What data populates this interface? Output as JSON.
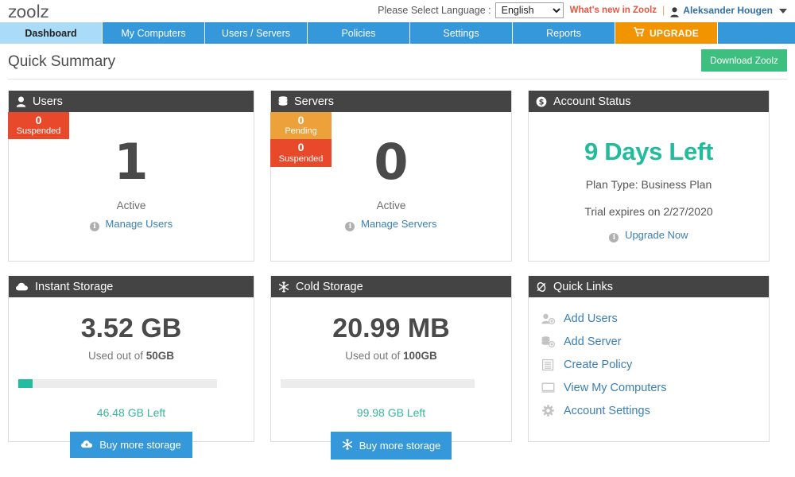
{
  "brand": {
    "logo_text": "zoolz"
  },
  "header": {
    "language_label": "Please Select Language :",
    "language_selected": "English",
    "language_options": [
      "English"
    ],
    "whats_new": "What's new in Zoolz",
    "separator": "|",
    "user_name": "Aleksander Hougen",
    "user_icon": "user-icon",
    "caret_icon": "chevron-down-icon"
  },
  "nav": {
    "tabs": [
      {
        "label": "Dashboard",
        "active": true
      },
      {
        "label": "My Computers",
        "active": false
      },
      {
        "label": "Users / Servers",
        "active": false
      },
      {
        "label": "Policies",
        "active": false
      },
      {
        "label": "Settings",
        "active": false
      },
      {
        "label": "Reports",
        "active": false
      }
    ],
    "upgrade": {
      "label": "UPGRADE",
      "icon": "cart-icon",
      "color": "#f29400"
    }
  },
  "page": {
    "title": "Quick Summary",
    "download_button": "Download Zoolz"
  },
  "cards": {
    "users": {
      "title": "Users",
      "icon": "person-icon",
      "badge": {
        "count": "0",
        "label": "Suspended",
        "color": "#e8492a"
      },
      "value": "1",
      "status": "Active",
      "link": "Manage Users"
    },
    "servers": {
      "title": "Servers",
      "icon": "database-icon",
      "badges": [
        {
          "count": "0",
          "label": "Pending",
          "color": "#eda13a"
        },
        {
          "count": "0",
          "label": "Suspended",
          "color": "#e8492a"
        }
      ],
      "value": "0",
      "status": "Active",
      "link": "Manage Servers"
    },
    "account_status": {
      "title": "Account Status",
      "icon": "dollar-circle-icon",
      "days_left": "9 Days Left",
      "plan_type": "Plan Type: Business Plan",
      "trial_expires": "Trial expires on 2/27/2020",
      "link": "Upgrade Now",
      "accent_color": "#22bb9c"
    },
    "instant_storage": {
      "title": "Instant Storage",
      "icon": "cloud-icon",
      "used": "3.52 GB",
      "used_out_of_prefix": "Used out of ",
      "quota": "50GB",
      "percent_used": 7,
      "left": "46.48 GB Left",
      "buy_button": "Buy more storage",
      "buy_icon": "cloud-download-icon"
    },
    "cold_storage": {
      "title": "Cold Storage",
      "icon": "snowflake-icon",
      "used": "20.99 MB",
      "used_out_of_prefix": "Used out of ",
      "quota": "100GB",
      "percent_used": 0,
      "left": "99.98 GB Left",
      "buy_button": "Buy more storage",
      "buy_icon": "snowflake-icon"
    },
    "quick_links": {
      "title": "Quick Links",
      "icon": "link-icon",
      "items": [
        {
          "label": "Add Users",
          "icon": "add-user-icon"
        },
        {
          "label": "Add Server",
          "icon": "add-server-icon"
        },
        {
          "label": "Create Policy",
          "icon": "list-icon"
        },
        {
          "label": "View My Computers",
          "icon": "monitor-icon"
        },
        {
          "label": "Account Settings",
          "icon": "gear-icon"
        }
      ]
    }
  }
}
